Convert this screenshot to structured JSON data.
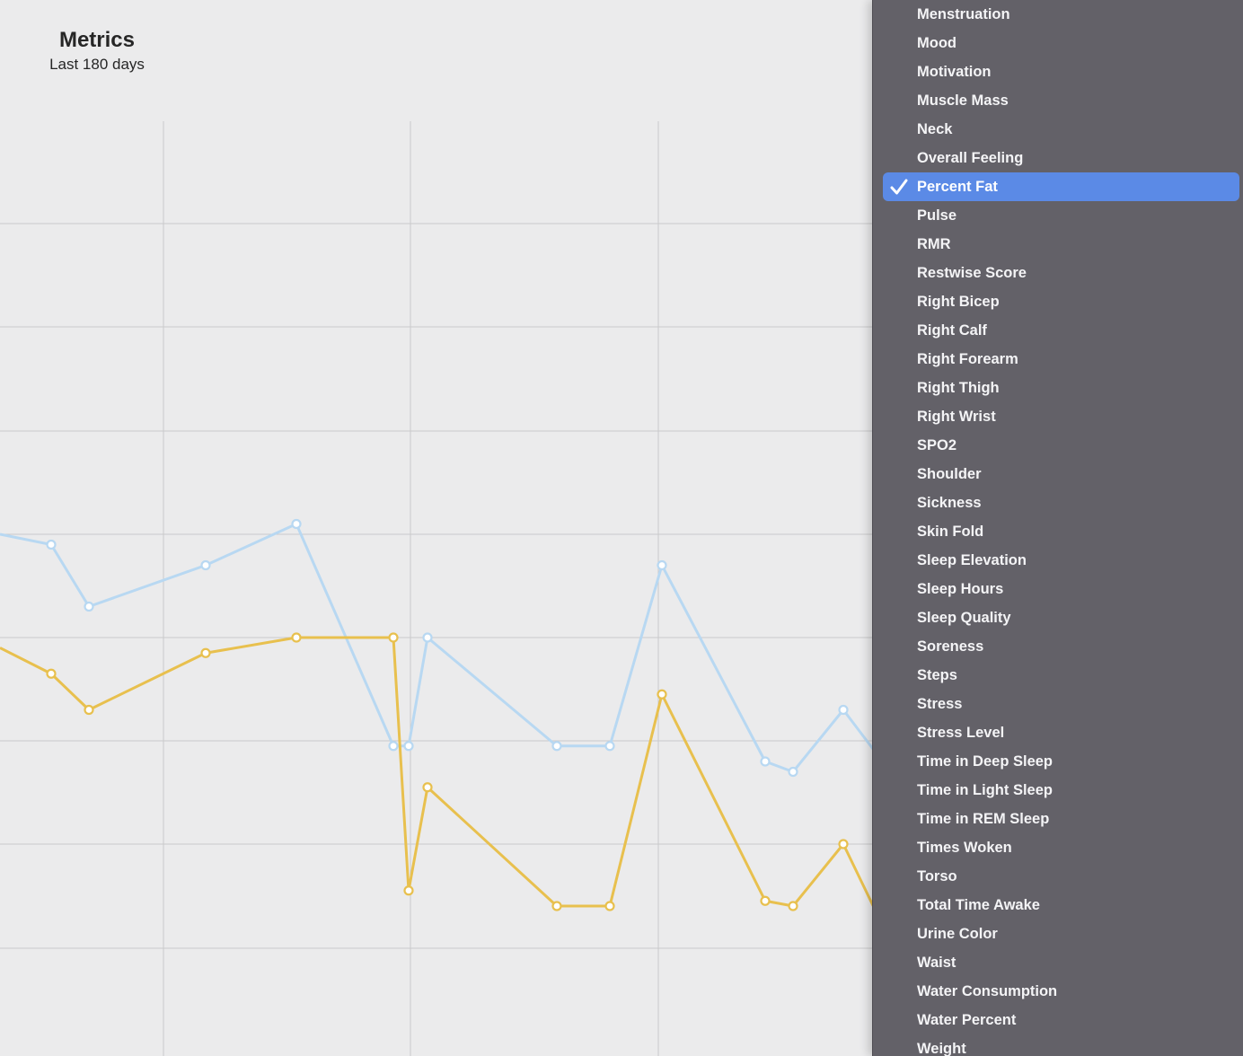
{
  "header": {
    "title": "Metrics",
    "subtitle": "Last 180 days"
  },
  "colors": {
    "background": "#ebebec",
    "grid": "#c9c9cb",
    "series_blue": "#b8d8f2",
    "series_gold": "#e8c04e",
    "menu_background": "#636168",
    "menu_selected": "#5b8ae6",
    "menu_text": "#f4f4f6"
  },
  "chart_data": {
    "type": "line",
    "grid": true,
    "legend": "none",
    "x": [
      0,
      57,
      99,
      229,
      330,
      438,
      455,
      476,
      620,
      679,
      737,
      852,
      883,
      939,
      1000
    ],
    "series": [
      {
        "color": "#b8d8f2",
        "values": [
          3.0,
          2.9,
          2.3,
          2.7,
          3.1,
          0.95,
          0.95,
          2.0,
          0.95,
          0.95,
          2.7,
          0.8,
          0.7,
          1.3,
          0.6
        ]
      },
      {
        "color": "#e8c04e",
        "values": [
          1.9,
          1.65,
          1.3,
          1.85,
          2.0,
          2.0,
          -0.45,
          0.55,
          -0.6,
          -0.6,
          1.45,
          -0.55,
          -0.6,
          0.0,
          -1.1
        ]
      }
    ],
    "ylim": [
      -1.5,
      4.0
    ],
    "markers": true
  },
  "menu": {
    "selected_index": 6,
    "check_icon": "checkmark-icon",
    "items": [
      "Menstruation",
      "Mood",
      "Motivation",
      "Muscle Mass",
      "Neck",
      "Overall Feeling",
      "Percent Fat",
      "Pulse",
      "RMR",
      "Restwise Score",
      "Right Bicep",
      "Right Calf",
      "Right Forearm",
      "Right Thigh",
      "Right Wrist",
      "SPO2",
      "Shoulder",
      "Sickness",
      "Skin Fold",
      "Sleep Elevation",
      "Sleep Hours",
      "Sleep Quality",
      "Soreness",
      "Steps",
      "Stress",
      "Stress Level",
      "Time in Deep Sleep",
      "Time in Light Sleep",
      "Time in REM Sleep",
      "Times Woken",
      "Torso",
      "Total Time Awake",
      "Urine Color",
      "Waist",
      "Water Consumption",
      "Water Percent",
      "Weight"
    ]
  }
}
